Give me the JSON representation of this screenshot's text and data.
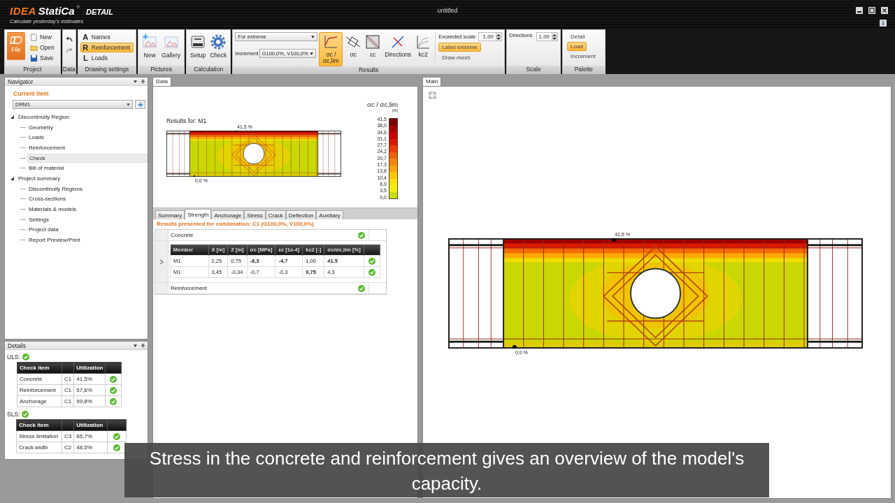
{
  "app": {
    "logo": "IDEA",
    "brand": "StatiCa",
    "registered": "®",
    "product": "DETAIL",
    "tagline": "Calculate yesterday's estimates"
  },
  "window": {
    "title": "untitled"
  },
  "ribbon": {
    "project": {
      "label": "Project",
      "file": "File",
      "items": [
        "New",
        "Open",
        "Save"
      ]
    },
    "data": {
      "label": "Data"
    },
    "drawing_settings": {
      "label": "Drawing settings",
      "items": [
        {
          "glyph": "A",
          "label": "Names",
          "selected": false
        },
        {
          "glyph": "R",
          "label": "Reinforcement",
          "selected": true
        },
        {
          "glyph": "L",
          "label": "Loads",
          "selected": false
        }
      ]
    },
    "pictures": {
      "label": "Pictures",
      "items": [
        "New",
        "Gallery"
      ]
    },
    "calculation": {
      "label": "Calculation",
      "items": [
        "Setup",
        "Check"
      ]
    },
    "results": {
      "label": "Results",
      "mode": "For extreme",
      "increment_label": "Increment",
      "increment": "G100,0%, V100,0%",
      "views": [
        {
          "label": "σc / σc,lim",
          "selected": true
        },
        {
          "label": "σc",
          "selected": false
        },
        {
          "label": "εc",
          "selected": false
        },
        {
          "label": "Directions",
          "selected": false
        },
        {
          "label": "kc2",
          "selected": false
        }
      ],
      "exceeded_scale_label": "Exceeded scale",
      "exceeded_scale": "1,00",
      "options": [
        {
          "label": "Label extreme",
          "selected": true
        },
        {
          "label": "Draw mesh",
          "selected": false
        }
      ]
    },
    "scale": {
      "label": "Scale",
      "directions_label": "Directions",
      "directions": "1,00"
    },
    "palette": {
      "label": "Palette",
      "items": [
        {
          "label": "Detail",
          "selected": false
        },
        {
          "label": "Load",
          "selected": true
        },
        {
          "label": "Increment",
          "selected": false
        }
      ]
    }
  },
  "navigator": {
    "title": "Navigator",
    "current_item_label": "Current item",
    "current_item": "DRM1",
    "tree": [
      {
        "label": "Discontinuity Region",
        "expanded": true,
        "selected": false,
        "children": [
          {
            "label": "Geometry",
            "selected": false
          },
          {
            "label": "Loads",
            "selected": false
          },
          {
            "label": "Reinforcement",
            "selected": false
          },
          {
            "label": "Check",
            "selected": true
          },
          {
            "label": "Bill of material",
            "selected": false
          }
        ]
      },
      {
        "label": "Project summary",
        "expanded": true,
        "selected": false,
        "children": [
          {
            "label": "Discontinuity Regions",
            "selected": false
          },
          {
            "label": "Cross-sections",
            "selected": false
          },
          {
            "label": "Materials & models",
            "selected": false
          },
          {
            "label": "Settings",
            "selected": false
          },
          {
            "label": "Project data",
            "selected": false
          },
          {
            "label": "Report Preview/Print",
            "selected": false
          }
        ]
      }
    ]
  },
  "details": {
    "title": "Details",
    "sections": [
      {
        "label": "ULS:",
        "ok": true,
        "columns": [
          "Check item",
          "Utilization"
        ],
        "rows": [
          {
            "item": "Concrete",
            "combination": "C1",
            "utilization": "41,5%",
            "ok": true
          },
          {
            "item": "Reinforcement",
            "combination": "C1",
            "utilization": "57,6%",
            "ok": true
          },
          {
            "item": "Anchorage",
            "combination": "C1",
            "utilization": "99,8%",
            "ok": true
          }
        ]
      },
      {
        "label": "SLS:",
        "ok": true,
        "columns": [
          "Check item",
          "Utilization"
        ],
        "rows": [
          {
            "item": "Stress limitation",
            "combination": "C3",
            "utilization": "65,7%",
            "ok": true
          },
          {
            "item": "Crack width",
            "combination": "C2",
            "utilization": "48,5%",
            "ok": true
          }
        ]
      }
    ]
  },
  "data_panel": {
    "tab": "Data",
    "preview": {
      "title": "Results for: M1",
      "max_label": "41,5 %",
      "min_label": "0,0 %"
    },
    "legend": {
      "title": "σc / σc,lim",
      "unit": "[%]",
      "ticks": [
        "41,5",
        "38,0",
        "34,6",
        "31,1",
        "27,7",
        "24,2",
        "20,7",
        "17,3",
        "13,8",
        "10,4",
        "6,9",
        "3,5",
        "0,0"
      ]
    },
    "tabs": [
      {
        "label": "Summary",
        "selected": false
      },
      {
        "label": "Strength",
        "selected": true
      },
      {
        "label": "Anchorage",
        "selected": false
      },
      {
        "label": "Stress",
        "selected": false
      },
      {
        "label": "Crack",
        "selected": false
      },
      {
        "label": "Deflection",
        "selected": false
      },
      {
        "label": "Auxiliary",
        "selected": false
      }
    ],
    "combination": "Results presented for combination: C1 (G100,0%, V100,0%)",
    "sections": [
      {
        "label": "Concrete",
        "ok": true,
        "expanded": true,
        "columns": [
          "Member",
          "X [m]",
          "Z [m]",
          "σc [MPa]",
          "εc [1e-4]",
          "kc2 [-]",
          "σc/σc,lim [%]"
        ],
        "rows": [
          {
            "cells": [
              "M1",
              "2,25",
              "0,75",
              "-8,3",
              "-4,7",
              "1,00",
              "41.5"
            ],
            "bold": [
              false,
              false,
              false,
              true,
              true,
              false,
              true
            ],
            "ok": true
          },
          {
            "cells": [
              "M1",
              "3,45",
              "-0,34",
              "-0,7",
              "-0,3",
              "0,75",
              "4,3"
            ],
            "bold": [
              false,
              false,
              false,
              false,
              false,
              true,
              false
            ],
            "ok": true
          }
        ]
      },
      {
        "label": "Reinforcement",
        "ok": true,
        "expanded": false
      }
    ]
  },
  "main_panel": {
    "tab": "Main",
    "max_label": "41,5 %",
    "min_label": "0,0 %"
  },
  "caption": "Stress in the concrete and reinforcement gives an overview of the model's capacity."
}
